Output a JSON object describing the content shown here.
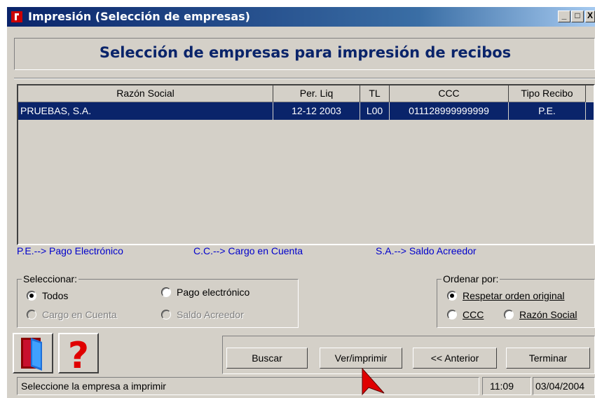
{
  "window": {
    "title": "Impresión (Selección de empresas)",
    "controls": [
      "_",
      "□",
      "X"
    ]
  },
  "heading": "Selección de empresas para impresión de recibos",
  "table": {
    "columns": [
      "Razón Social",
      "Per. Liq",
      "TL",
      "CCC",
      "Tipo Recibo"
    ],
    "rows": [
      {
        "razon": "PRUEBAS, S.A.",
        "per": "12-12 2003",
        "tl": "L00",
        "ccc": "011128999999999",
        "tipo": "P.E."
      }
    ]
  },
  "legend": {
    "pe": "P.E.--> Pago Electrónico",
    "cc": "C.C.--> Cargo en Cuenta",
    "sa": "S.A.--> Saldo Acreedor"
  },
  "seleccionar": {
    "title": "Seleccionar:",
    "todos": "Todos",
    "pago": "Pago electrónico",
    "cargo": "Cargo en  Cuenta",
    "saldo": "Saldo Acreedor"
  },
  "ordenar": {
    "title": "Ordenar por:",
    "respetar": "Respetar orden original",
    "ccc": "CCC",
    "razon": "Razón Social"
  },
  "buttons": {
    "buscar": "Buscar",
    "ver": "Ver/imprimir",
    "anterior": "<< Anterior",
    "terminar": "Terminar"
  },
  "status": {
    "message": "Seleccione la empresa a imprimir",
    "time": "11:09",
    "date": "03/04/2004"
  },
  "icons": {
    "exit": "exit-door-icon",
    "help": "help-question-icon"
  },
  "colors": {
    "selection": "#0a246a",
    "legend": "#0000cc",
    "heading": "#0a246a",
    "help": "#e00000"
  }
}
